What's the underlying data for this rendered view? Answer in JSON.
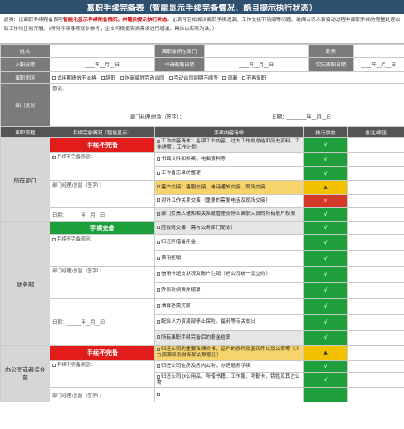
{
  "title": "离职手续完备表（智能显示手续完备情况，酷目提示执行状态）",
  "description": "说明：此离职手续完备表可智能化显示手续完备情况，并醒目提示执行状态。此表可轻松解决离职手续遗漏、工作交接不彻底等问题，确保公司人事变动过程中离职手续的完整处理以及工作的正常开展。（所列手续事项仅供参考，企业可根据实际需求进行增减，具体以实际为准。）",
  "description_highlight": "智能化显示手续完备情况，并醒目提示执行状态",
  "form": {
    "name_label": "姓名",
    "dept_label": "离职前所在部门",
    "position_label": "职务",
    "entry_label": "入职日期",
    "entry_value": "____年__月__日",
    "apply_label": "申请离职日期",
    "apply_value": "____年__月__日",
    "actual_label": "实际离职日期",
    "actual_value": "____年__月__日",
    "reason_label": "离职原因",
    "reasons": [
      "试用期绩效不合格",
      "辞职",
      "协商解除劳动合同",
      "劳动合同到期不续签",
      "调离",
      "不再复职"
    ],
    "opinion_label": "部门意见",
    "opinion_hint": "意见:",
    "opinion_sign": "部门经理/总监（签字）：",
    "opinion_date": "日期：________年__月__日"
  },
  "table_headers": [
    "离职流程",
    "手续完备情况（智能显示）",
    "手续内容清单",
    "执行状态",
    "备注/原因"
  ],
  "sections": [
    {
      "name": "所在部门",
      "status": "手续不完备",
      "status_color": "red",
      "check_hint": "手续不完备原因：",
      "sign": "部门经理/总监（签字）：",
      "date": "日期：______年__月__日",
      "items": [
        {
          "text": "工作内容清单：各项工作内容，过去工作的总结和历史资料，工作进度，工作计划",
          "status": "√",
          "state": "ok"
        },
        {
          "text": "书面文件和档案、电脑资料等",
          "status": "√",
          "state": "ok"
        },
        {
          "text": "工作备忘录的整理",
          "status": "√",
          "state": "ok"
        },
        {
          "text": "客户交接：客服交接、电话通知交接、现场交接",
          "status": "▲",
          "state": "warn"
        },
        {
          "text": "对外工作关系交接（重要的需要电话及现场交接）",
          "status": "×",
          "state": "bad"
        },
        {
          "text": "部门负责人通知相关系统管理员停止离职人员的所有账户权限",
          "status": "√",
          "state": "ok"
        }
      ]
    },
    {
      "name": "财务部",
      "status": "手续完备",
      "status_color": "green",
      "check_hint": "手续不完备原因：",
      "sign": "部门经理/总监（签字）：",
      "date": "日期：______年__月__日",
      "items": [
        {
          "text": "应收账交接（需与公务部门配合）",
          "status": "√",
          "state": "ok"
        },
        {
          "text": "归还所借备用金",
          "status": "√",
          "state": "ok"
        },
        {
          "text": "费用报销",
          "status": "√",
          "state": "ok"
        },
        {
          "text": "信用卡透支状况及账户注销（经公司统一设立的）",
          "status": "√",
          "state": "ok"
        },
        {
          "text": "外派培训费用结算",
          "status": "√",
          "state": "ok"
        },
        {
          "text": "清算各类欠款",
          "status": "√",
          "state": "ok"
        },
        {
          "text": "配合人力资源部停止保险、福利等有关支出",
          "status": "√",
          "state": "ok"
        },
        {
          "text": "所有离职手续完备后的薪金结算",
          "status": "√",
          "state": "ok"
        }
      ]
    },
    {
      "name": "办公室或者综合部",
      "status": "手续不完备",
      "status_color": "red",
      "check_hint": "手续不完备原因：",
      "sign": "部门经理/总监（签字）：",
      "date": "",
      "items": [
        {
          "text": "归还公司的重要法律文书、证件的原件及复印件以及公章等（人力资源部及财务部关联意见）",
          "status": "▲",
          "state": "warn"
        },
        {
          "text": "归还公司住房及房内公物，办理退房手续",
          "status": "√",
          "state": "ok"
        },
        {
          "text": "归还公司办公用品、所借书籍、工作服、考勤卡、钥匙及其它公物",
          "status": "√",
          "state": "ok"
        },
        {
          "text": "",
          "status": "",
          "state": "ok"
        }
      ]
    }
  ]
}
